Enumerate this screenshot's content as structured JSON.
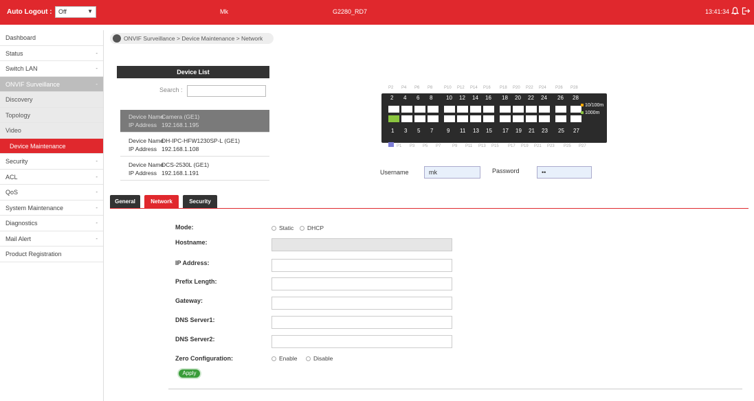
{
  "header": {
    "auto_logout_label": "Auto Logout :",
    "auto_logout_value": "Off",
    "user": "Mk",
    "device_name": "G2280_RD7",
    "time": "13:41:34",
    "brand_color": "#e0282d",
    "icons": [
      "bell-icon",
      "logout-icon"
    ]
  },
  "sidebar": {
    "items": [
      {
        "label": "Dashboard",
        "arrow": ""
      },
      {
        "label": "Status",
        "arrow": "-"
      },
      {
        "label": "Switch LAN",
        "arrow": "-"
      },
      {
        "label": "ONVIF Surveillance",
        "arrow": "-"
      },
      {
        "label": "Discovery",
        "arrow": ""
      },
      {
        "label": "Topology",
        "arrow": ""
      },
      {
        "label": "Video",
        "arrow": ""
      },
      {
        "label": "Device Maintenance",
        "arrow": ""
      },
      {
        "label": "Security",
        "arrow": "-"
      },
      {
        "label": "ACL",
        "arrow": "-"
      },
      {
        "label": "QoS",
        "arrow": "-"
      },
      {
        "label": "System Maintenance",
        "arrow": "-"
      },
      {
        "label": "Diagnostics",
        "arrow": "-"
      },
      {
        "label": "Mail Alert",
        "arrow": "-"
      },
      {
        "label": "Product Registration",
        "arrow": ""
      }
    ]
  },
  "breadcrumb": "ONVIF Surveillance > Device Maintenance > Network",
  "device_list": {
    "title": "Device List",
    "search_label": "Search :",
    "name_label": "Device Name",
    "ip_label": "IP Address",
    "devices": [
      {
        "name": "Camera (GE1)",
        "ip": "192.168.1.195"
      },
      {
        "name": "DH-IPC-HFW1230SP-L (GE1)",
        "ip": "192.168.1.108"
      },
      {
        "name": "DCS-2530L (GE1)",
        "ip": "192.168.1.191"
      }
    ]
  },
  "switch": {
    "top_labels": [
      "P2",
      "P4",
      "P6",
      "P8",
      "P10",
      "P12",
      "P14",
      "P16",
      "P18",
      "P20",
      "P22",
      "P24",
      "P26",
      "P28"
    ],
    "top_nums": [
      "2",
      "4",
      "6",
      "8",
      "10",
      "12",
      "14",
      "16",
      "18",
      "20",
      "22",
      "24",
      "26",
      "28"
    ],
    "bot_nums": [
      "1",
      "3",
      "5",
      "7",
      "9",
      "11",
      "13",
      "15",
      "17",
      "19",
      "21",
      "23",
      "25",
      "27"
    ],
    "bot_labels": [
      "P1",
      "P3",
      "P5",
      "P7",
      "P9",
      "P11",
      "P13",
      "P15",
      "P17",
      "P19",
      "P21",
      "P23",
      "P25",
      "P27"
    ],
    "legend": [
      {
        "label": "10/100m",
        "color": "#f7a600"
      },
      {
        "label": "1000m",
        "color": "#8bc53f"
      }
    ],
    "active_port": "P1"
  },
  "credentials": {
    "username_label": "Username",
    "username_value": "mk",
    "password_label": "Password",
    "password_value": "••"
  },
  "tabs": [
    "General",
    "Network",
    "Security"
  ],
  "form": {
    "mode_label": "Mode:",
    "mode_options": [
      "Static",
      "DHCP"
    ],
    "hostname_label": "Hostname:",
    "ip_label": "IP Address:",
    "prefix_label": "Prefix Length:",
    "gateway_label": "Gateway:",
    "dns1_label": "DNS Server1:",
    "dns2_label": "DNS Server2:",
    "zero_label": "Zero Configuration:",
    "zero_options": [
      "Enable",
      "Disable"
    ],
    "apply_label": "Apply"
  }
}
